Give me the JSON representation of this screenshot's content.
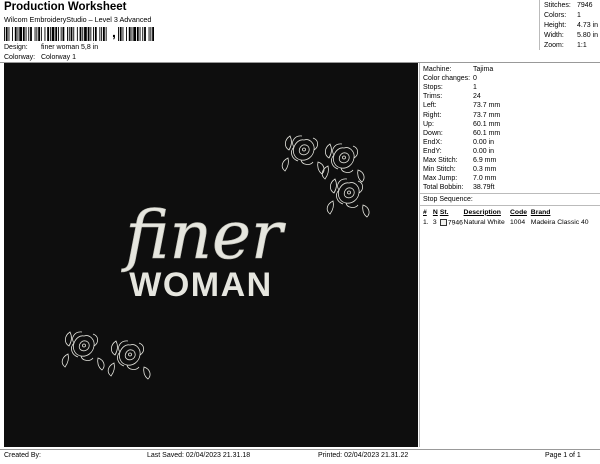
{
  "header": {
    "title": "Production Worksheet",
    "subtitle": "Wilcom EmbroideryStudio – Level 3 Advanced",
    "barcode_suffix": ","
  },
  "meta": {
    "design_label": "Design:",
    "design_value": "finer woman 5,8 in",
    "colorway_label": "Colorway:",
    "colorway_value": "Colorway 1"
  },
  "stats": [
    {
      "label": "Stitches:",
      "value": "7946"
    },
    {
      "label": "Colors:",
      "value": "1"
    },
    {
      "label": "Height:",
      "value": "4.73 in"
    },
    {
      "label": "Width:",
      "value": "5.80 in"
    },
    {
      "label": "Zoom:",
      "value": "1:1"
    }
  ],
  "design": {
    "script_text": "finer",
    "block_text": "WOMAN",
    "background": "#0e0e0e",
    "thread_color": "#e6e6df"
  },
  "machine": [
    {
      "label": "Machine:",
      "value": "Tajima"
    },
    {
      "label": "Color changes:",
      "value": "0"
    },
    {
      "label": "Stops:",
      "value": "1"
    },
    {
      "label": "Trims:",
      "value": "24"
    },
    {
      "label": "Left:",
      "value": "73.7 mm"
    },
    {
      "label": "Right:",
      "value": "73.7 mm"
    },
    {
      "label": "Up:",
      "value": "60.1 mm"
    },
    {
      "label": "Down:",
      "value": "60.1 mm"
    },
    {
      "label": "EndX:",
      "value": "0.00 in"
    },
    {
      "label": "EndY:",
      "value": "0.00 in"
    },
    {
      "label": "Max Stitch:",
      "value": "6.9 mm"
    },
    {
      "label": "Min Stitch:",
      "value": "0.3 mm"
    },
    {
      "label": "Max Jump:",
      "value": "7.0 mm"
    },
    {
      "label": "Total Bobbin:",
      "value": "38.79ft"
    }
  ],
  "stop_sequence": {
    "title": "Stop Sequence:",
    "headers": [
      "#",
      "N",
      "St.",
      "Description",
      "Code",
      "Brand"
    ],
    "rows": [
      {
        "num": "1.",
        "n": "3",
        "st": "7946",
        "description": "Natural White",
        "code": "1004",
        "brand": "Madeira Classic 40",
        "swatch": "#f2f2ef"
      }
    ]
  },
  "footer": {
    "created_by": "Created By:",
    "last_saved": "Last Saved: 02/04/2023 21.31.18",
    "printed": "Printed: 02/04/2023 21.31.22",
    "page": "Page 1 of 1"
  }
}
